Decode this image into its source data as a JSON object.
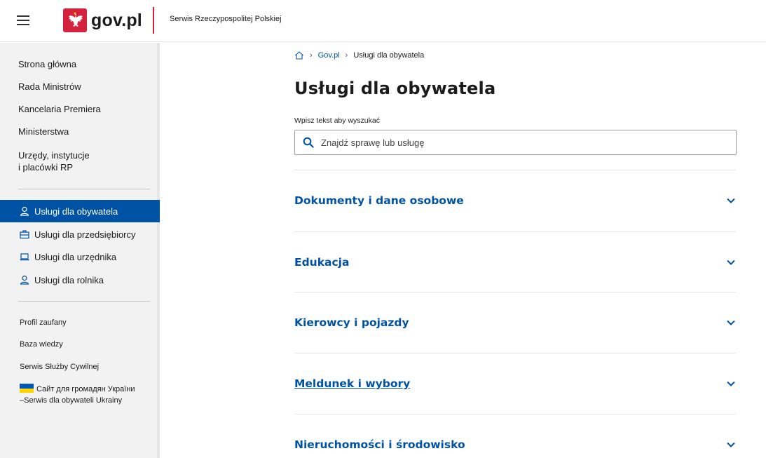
{
  "header": {
    "logo_text": "gov.pl",
    "subtitle": "Serwis Rzeczypospolitej Polskiej"
  },
  "sidebar": {
    "main_links": [
      {
        "label": "Strona główna"
      },
      {
        "label": "Rada Ministrów"
      },
      {
        "label": "Kancelaria Premiera"
      },
      {
        "label": "Ministerstwa"
      },
      {
        "label_line1": "Urzędy, instytucje",
        "label_line2": "i placówki RP"
      }
    ],
    "services": [
      {
        "label": "Usługi dla obywatela",
        "icon": "person-icon",
        "active": true
      },
      {
        "label": "Usługi dla przedsiębiorcy",
        "icon": "briefcase-icon",
        "active": false
      },
      {
        "label": "Usługi dla urzędnika",
        "icon": "laptop-icon",
        "active": false
      },
      {
        "label": "Usługi dla rolnika",
        "icon": "person-icon",
        "active": false
      }
    ],
    "extra_links": [
      {
        "label": "Profil zaufany"
      },
      {
        "label": "Baza wiedzy"
      },
      {
        "label": "Serwis Służby Cywilnej"
      },
      {
        "label_line1": "Сайт для громадян України",
        "label_line2": "–Serwis dla obywateli Ukrainy",
        "icon": "ukraine-flag-icon"
      }
    ]
  },
  "breadcrumb": {
    "items": [
      {
        "label": "Gov.pl"
      },
      {
        "label": "Usługi dla obywatela"
      }
    ]
  },
  "main": {
    "title": "Usługi dla obywatela",
    "search": {
      "label": "Wpisz tekst aby wyszukać",
      "placeholder": "Znajdź sprawę lub usługę",
      "value": ""
    },
    "categories": [
      {
        "label": "Dokumenty i dane osobowe"
      },
      {
        "label": "Edukacja"
      },
      {
        "label": "Kierowcy i pojazdy"
      },
      {
        "label": "Meldunek i wybory"
      },
      {
        "label": "Nieruchomości i środowisko"
      }
    ]
  },
  "colors": {
    "primary_blue": "#0052a5",
    "brand_red": "#d4213d",
    "sidebar_bg": "#f2f2f2"
  }
}
